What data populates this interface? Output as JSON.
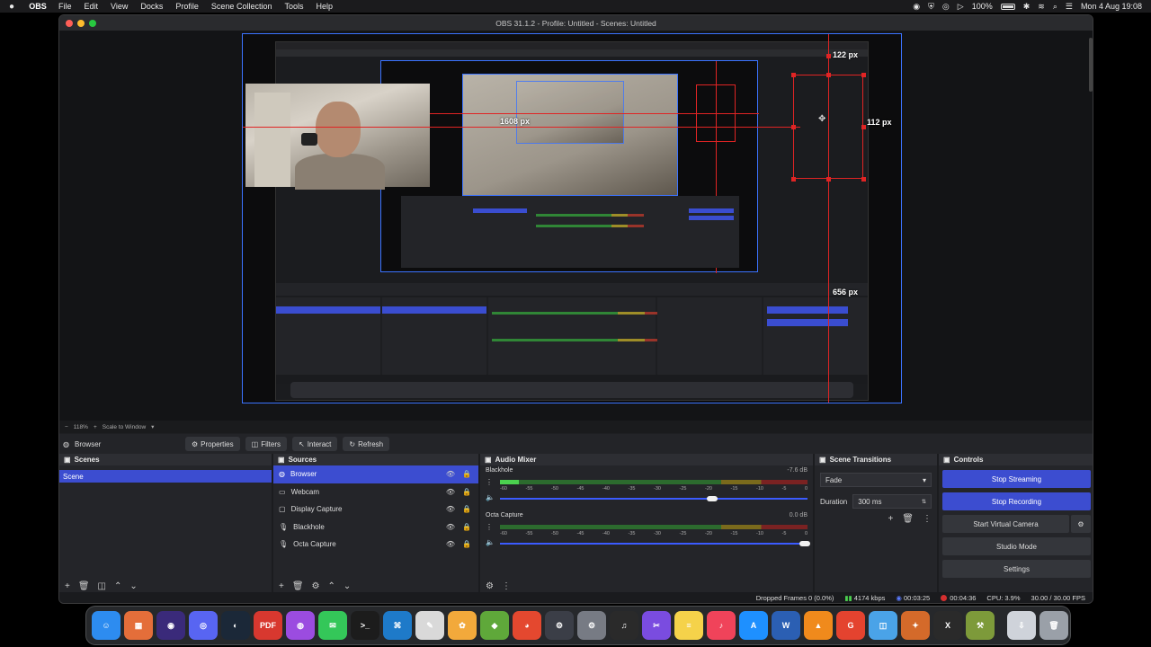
{
  "menubar": {
    "app": "OBS",
    "items": [
      "File",
      "Edit",
      "View",
      "Docks",
      "Profile",
      "Scene Collection",
      "Tools",
      "Help"
    ],
    "battery": "100%",
    "clock": "Mon 4 Aug  19:08"
  },
  "window": {
    "title": "OBS 31.1.2 - Profile: Untitled - Scenes: Untitled"
  },
  "preview": {
    "labels": {
      "top": "122 px",
      "right": "112 px",
      "left": "1608 px",
      "bottom": "656 px"
    }
  },
  "zoombar": {
    "zoom": "118%",
    "mode": "Scale to Window"
  },
  "contextbar": {
    "source": "Browser",
    "properties": "Properties",
    "filters": "Filters",
    "interact": "Interact",
    "refresh": "Refresh"
  },
  "scenes": {
    "title": "Scenes",
    "items": [
      "Scene"
    ]
  },
  "sources": {
    "title": "Sources",
    "items": [
      {
        "name": "Browser",
        "icon": "globe-icon"
      },
      {
        "name": "Webcam",
        "icon": "camera-icon"
      },
      {
        "name": "Display Capture",
        "icon": "monitor-icon"
      },
      {
        "name": "Blackhole",
        "icon": "mic-icon"
      },
      {
        "name": "Octa Capture",
        "icon": "mic-icon"
      }
    ]
  },
  "mixer": {
    "title": "Audio Mixer",
    "scale": [
      "-60",
      "-55",
      "-50",
      "-45",
      "-40",
      "-35",
      "-30",
      "-25",
      "-20",
      "-15",
      "-10",
      "-5",
      "0"
    ],
    "channels": [
      {
        "name": "Blackhole",
        "db": "-7.6 dB",
        "level": 0.06,
        "volume": 0.69
      },
      {
        "name": "Octa Capture",
        "db": "0.0 dB",
        "level": 0,
        "volume": 0.99
      }
    ]
  },
  "transitions": {
    "title": "Scene Transitions",
    "type": "Fade",
    "duration_label": "Duration",
    "duration": "300 ms"
  },
  "controls": {
    "title": "Controls",
    "stop_streaming": "Stop Streaming",
    "stop_recording": "Stop Recording",
    "virtual_camera": "Start Virtual Camera",
    "studio_mode": "Studio Mode",
    "settings": "Settings"
  },
  "status": {
    "dropped": "Dropped Frames 0 (0.0%)",
    "bitrate": "4174 kbps",
    "stream_time": "00:03:25",
    "record_time": "00:04:36",
    "cpu": "CPU: 3.9%",
    "fps": "30.00 / 30.00 FPS"
  },
  "colors": {
    "accent": "#3c4dd0",
    "guide": "#e02424",
    "record": "#d42f2f",
    "meter_green": "#4bd14f"
  },
  "dock_apps": [
    {
      "name": "finder",
      "label": "☺",
      "color": "#2d8cf0"
    },
    {
      "name": "launchpad",
      "label": "▦",
      "color": "#e46e3a"
    },
    {
      "name": "obs",
      "label": "◉",
      "color": "#3a2a7a"
    },
    {
      "name": "discord",
      "label": "◎",
      "color": "#5865f2"
    },
    {
      "name": "steam",
      "label": "◐",
      "color": "#1b2838"
    },
    {
      "name": "pdf",
      "label": "PDF",
      "color": "#d8382f"
    },
    {
      "name": "podcasts",
      "label": "◍",
      "color": "#9b4ce0"
    },
    {
      "name": "messages",
      "label": "✉",
      "color": "#34c759"
    },
    {
      "name": "terminal",
      "label": ">_",
      "color": "#1c1c1c"
    },
    {
      "name": "vscode",
      "label": "⌘",
      "color": "#1e7ac9"
    },
    {
      "name": "textedit",
      "label": "✎",
      "color": "#d9d9d9"
    },
    {
      "name": "photos",
      "label": "✿",
      "color": "#f2a93b"
    },
    {
      "name": "chrome-like",
      "label": "◆",
      "color": "#5fa83a"
    },
    {
      "name": "chrome",
      "label": "◕",
      "color": "#e4482f"
    },
    {
      "name": "screen-capture",
      "label": "⚙",
      "color": "#3b3e47"
    },
    {
      "name": "system-settings",
      "label": "⚙",
      "color": "#777b84"
    },
    {
      "name": "piano",
      "label": "♫",
      "color": "#2a2a2a"
    },
    {
      "name": "final-cut",
      "label": "✂",
      "color": "#7a4ce0"
    },
    {
      "name": "notes",
      "label": "≡",
      "color": "#f5d24a"
    },
    {
      "name": "music",
      "label": "♪",
      "color": "#f0435a"
    },
    {
      "name": "app-store",
      "label": "A",
      "color": "#1e90ff"
    },
    {
      "name": "word",
      "label": "W",
      "color": "#2b5fb3"
    },
    {
      "name": "vlc",
      "label": "▲",
      "color": "#f08a1c"
    },
    {
      "name": "git",
      "label": "G",
      "color": "#e4432f"
    },
    {
      "name": "preview",
      "label": "◫",
      "color": "#4aa3e8"
    },
    {
      "name": "wand",
      "label": "✦",
      "color": "#d46a2a"
    },
    {
      "name": "xcode",
      "label": "X",
      "color": "#2a2a2a"
    },
    {
      "name": "toolbox",
      "label": "⚒",
      "color": "#7d9a3a"
    },
    {
      "name": "downloads",
      "label": "⇩",
      "color": "#cfd3da"
    },
    {
      "name": "trash",
      "label": "🗑",
      "color": "#9aa0a8"
    }
  ]
}
